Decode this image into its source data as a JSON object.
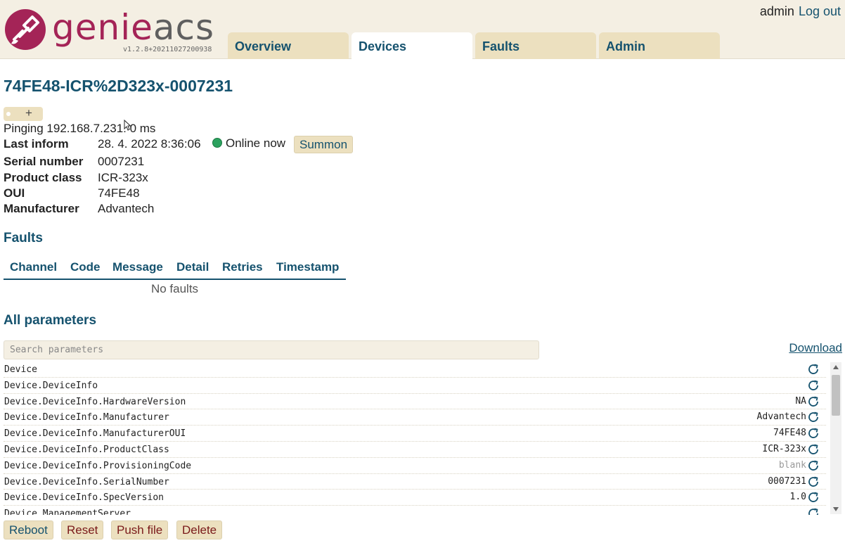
{
  "app": {
    "logo_part1": "genie",
    "logo_part2": "acs",
    "version": "v1.2.8+20211027200938",
    "brand_color": "#a42457",
    "accent_color": "#15526e"
  },
  "nav": {
    "tabs": [
      {
        "label": "Overview",
        "active": false
      },
      {
        "label": "Devices",
        "active": true
      },
      {
        "label": "Faults",
        "active": false
      },
      {
        "label": "Admin",
        "active": false
      }
    ]
  },
  "user": {
    "name": "admin",
    "logout_label": "Log out"
  },
  "device": {
    "title": "74FE48-ICR%2D323x-0007231",
    "tag_add_label": "+",
    "ping_text": "Pinging 192.168.7.231: 0 ms",
    "info": [
      {
        "label": "Last inform",
        "value": "28. 4. 2022 8:36:06"
      },
      {
        "label": "Serial number",
        "value": "0007231"
      },
      {
        "label": "Product class",
        "value": "ICR-323x"
      },
      {
        "label": "OUI",
        "value": "74FE48"
      },
      {
        "label": "Manufacturer",
        "value": "Advantech"
      }
    ],
    "online_status": "Online now",
    "online_color": "#2ca25f",
    "summon_label": "Summon"
  },
  "faults": {
    "heading": "Faults",
    "columns": [
      "Channel",
      "Code",
      "Message",
      "Detail",
      "Retries",
      "Timestamp"
    ],
    "empty_text": "No faults"
  },
  "parameters": {
    "heading": "All parameters",
    "search_placeholder": "Search parameters",
    "download_label": "Download",
    "rows": [
      {
        "name": "Device",
        "value": ""
      },
      {
        "name": "Device.DeviceInfo",
        "value": ""
      },
      {
        "name": "Device.DeviceInfo.HardwareVersion",
        "value": "NA"
      },
      {
        "name": "Device.DeviceInfo.Manufacturer",
        "value": "Advantech"
      },
      {
        "name": "Device.DeviceInfo.ManufacturerOUI",
        "value": "74FE48"
      },
      {
        "name": "Device.DeviceInfo.ProductClass",
        "value": "ICR-323x"
      },
      {
        "name": "Device.DeviceInfo.ProvisioningCode",
        "value": "blank"
      },
      {
        "name": "Device.DeviceInfo.SerialNumber",
        "value": "0007231"
      },
      {
        "name": "Device.DeviceInfo.SpecVersion",
        "value": "1.0"
      },
      {
        "name": "Device.ManagementServer",
        "value": ""
      }
    ]
  },
  "actions": {
    "reboot": "Reboot",
    "reset": "Reset",
    "push_file": "Push file",
    "delete": "Delete"
  }
}
